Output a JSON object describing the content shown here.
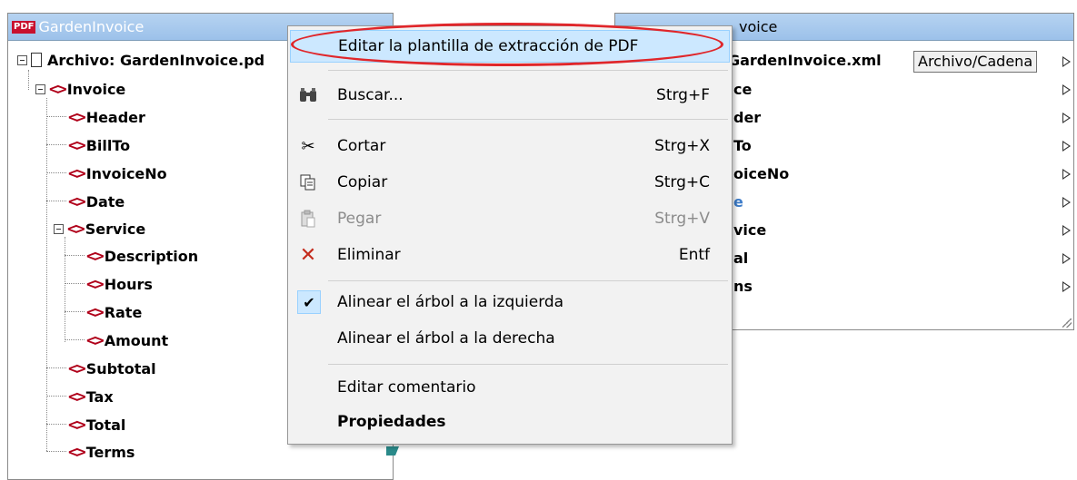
{
  "left_component": {
    "title": "GardenInvoice",
    "pdf_badge": "PDF",
    "root_label": "Archivo: GardenInvoice.pd",
    "items": [
      {
        "label": "Invoice"
      },
      {
        "label": "Header"
      },
      {
        "label": "BillTo"
      },
      {
        "label": "InvoiceNo"
      },
      {
        "label": "Date"
      },
      {
        "label": "Service"
      },
      {
        "label": "Description"
      },
      {
        "label": "Hours"
      },
      {
        "label": "Rate"
      },
      {
        "label": "Amount"
      },
      {
        "label": "Subtotal"
      },
      {
        "label": "Tax"
      },
      {
        "label": "Total"
      },
      {
        "label": "Terms"
      }
    ]
  },
  "right_component": {
    "title_visible": "voice",
    "root_label_visible": ": GardenInvoice.xml",
    "file_button": "Archivo/Cadena",
    "items_visible": [
      "ce",
      "der",
      "To",
      "oiceNo",
      "e",
      "vice",
      "al",
      "ns"
    ]
  },
  "context_menu": {
    "edit_pdf_template": "Editar la plantilla de extracción de PDF",
    "search": {
      "label": "Buscar...",
      "shortcut": "Strg+F"
    },
    "cut": {
      "label": "Cortar",
      "shortcut": "Strg+X"
    },
    "copy": {
      "label": "Copiar",
      "shortcut": "Strg+C"
    },
    "paste": {
      "label": "Pegar",
      "shortcut": "Strg+V"
    },
    "delete": {
      "label": "Eliminar",
      "shortcut": "Entf"
    },
    "align_left": "Alinear el árbol a la izquierda",
    "align_right": "Alinear el árbol a la derecha",
    "edit_comment": "Editar comentario",
    "properties": "Propiedades"
  },
  "colors": {
    "title_bar": "#a9cbef",
    "tag_icon": "#b0001a",
    "highlight": "#cce8ff",
    "annotation_oval": "#e0262a"
  }
}
